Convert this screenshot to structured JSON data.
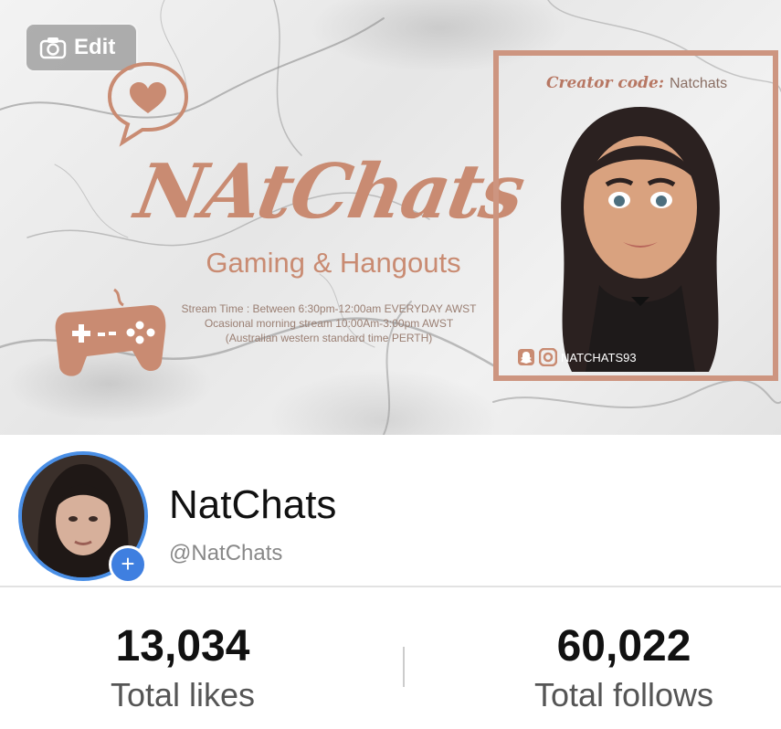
{
  "banner": {
    "edit_label": "Edit",
    "brand_title": "NAtChats",
    "tagline": "Gaming & Hangouts",
    "stream_lines": [
      "Stream Time : Between 6:30pm-12:00am EVERYDAY AWST",
      "Ocasional morning stream 10:00Am-3:00pm AWST",
      "(Australian western standard time PERTH)"
    ],
    "creator_label": "Creator code:",
    "creator_code": "Natchats",
    "social_handle": "NATCHATS93",
    "accent_color": "#c98b72"
  },
  "profile": {
    "display_name": "NatChats",
    "handle": "@NatChats",
    "follow_button": "+"
  },
  "stats": {
    "likes_value": "13,034",
    "likes_label": "Total likes",
    "follows_value": "60,022",
    "follows_label": "Total follows"
  },
  "icons": {
    "edit": "camera-icon",
    "chat": "heart-speech-bubble-icon",
    "controller": "gamepad-icon",
    "socials": [
      "snapchat-icon",
      "instagram-icon"
    ]
  }
}
